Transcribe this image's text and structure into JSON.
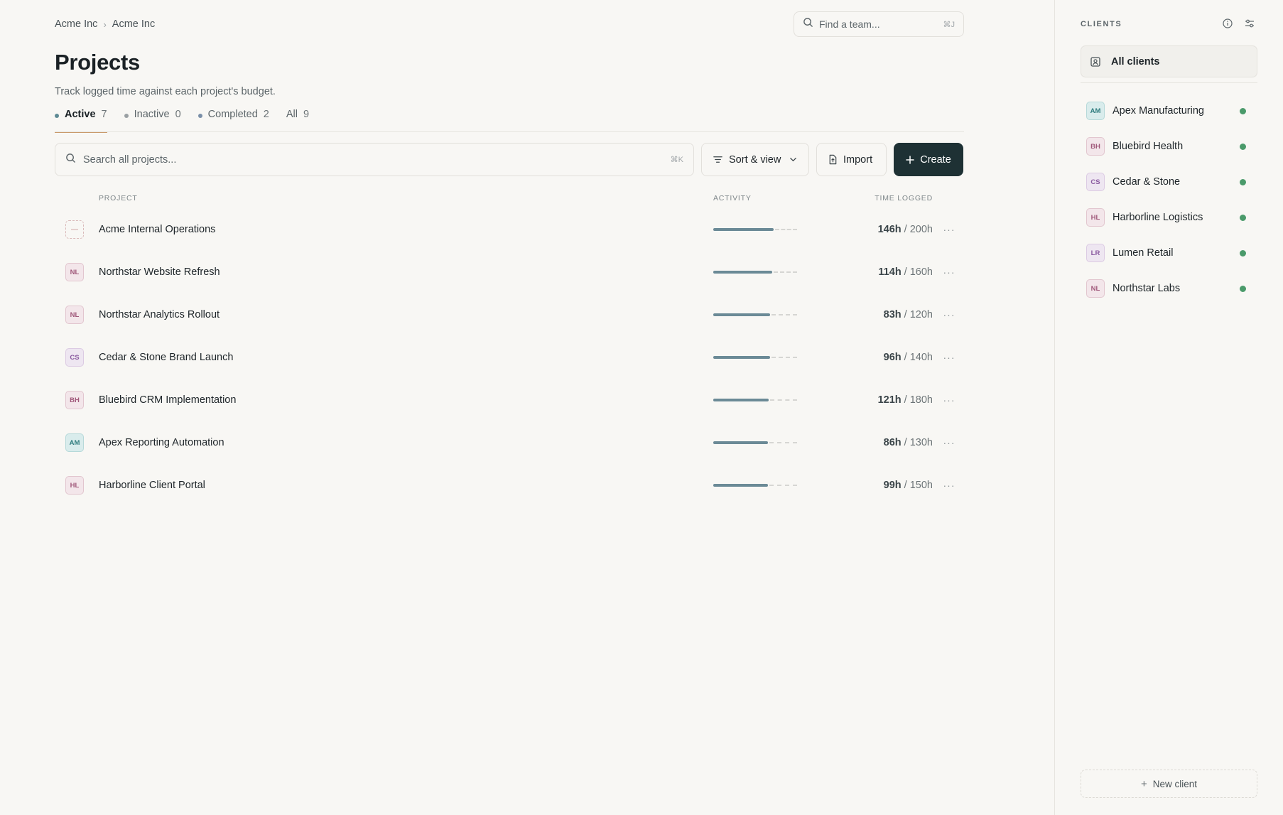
{
  "breadcrumb": [
    "Acme Inc",
    "Acme Inc"
  ],
  "team_search": {
    "placeholder": "Find a team...",
    "shortcut": "⌘J"
  },
  "page": {
    "title": "Projects",
    "subtitle": "Track logged time against each project's budget."
  },
  "tabs": [
    {
      "label": "Active",
      "count": "7",
      "active": true,
      "dot_color": "#5e8a94"
    },
    {
      "label": "Inactive",
      "count": "0",
      "active": false,
      "dot_color": "#9aa0a3"
    },
    {
      "label": "Completed",
      "count": "2",
      "active": false,
      "dot_color": "#7a8fa8"
    },
    {
      "label": "All",
      "count": "9",
      "active": false,
      "dot_color": null
    }
  ],
  "toolbar": {
    "search_placeholder": "Search all projects...",
    "search_shortcut": "⌘K",
    "sort_label": "Sort & view",
    "import_label": "Import",
    "create_label": "Create"
  },
  "table": {
    "columns": {
      "project": "PROJECT",
      "activity": "ACTIVITY",
      "time": "TIME LOGGED"
    },
    "rows": [
      {
        "initials": "",
        "name": "Acme Internal Operations",
        "logged": "146h",
        "budget": "/ 200h",
        "ratio": 0.73,
        "client_color": "none"
      },
      {
        "initials": "NL",
        "name": "Northstar Website Refresh",
        "logged": "114h",
        "budget": "/ 160h",
        "ratio": 0.71,
        "client_color": "pink"
      },
      {
        "initials": "NL",
        "name": "Northstar Analytics Rollout",
        "logged": "83h",
        "budget": "/ 120h",
        "ratio": 0.69,
        "client_color": "pink"
      },
      {
        "initials": "CS",
        "name": "Cedar & Stone Brand Launch",
        "logged": "96h",
        "budget": "/ 140h",
        "ratio": 0.69,
        "client_color": "purple"
      },
      {
        "initials": "BH",
        "name": "Bluebird CRM Implementation",
        "logged": "121h",
        "budget": "/ 180h",
        "ratio": 0.67,
        "client_color": "pink"
      },
      {
        "initials": "AM",
        "name": "Apex Reporting Automation",
        "logged": "86h",
        "budget": "/ 130h",
        "ratio": 0.66,
        "client_color": "teal"
      },
      {
        "initials": "HL",
        "name": "Harborline Client Portal",
        "logged": "99h",
        "budget": "/ 150h",
        "ratio": 0.66,
        "client_color": "pink"
      }
    ]
  },
  "sidebar": {
    "title": "CLIENTS",
    "all_clients_label": "All clients",
    "clients": [
      {
        "initials": "AM",
        "name": "Apex Manufacturing",
        "client_color": "teal",
        "status_color": "#4a9a6a"
      },
      {
        "initials": "BH",
        "name": "Bluebird Health",
        "client_color": "pink",
        "status_color": "#4a9a6a"
      },
      {
        "initials": "CS",
        "name": "Cedar & Stone",
        "client_color": "purple",
        "status_color": "#4a9a6a"
      },
      {
        "initials": "HL",
        "name": "Harborline Logistics",
        "client_color": "pink",
        "status_color": "#4a9a6a"
      },
      {
        "initials": "LR",
        "name": "Lumen Retail",
        "client_color": "purple",
        "status_color": "#4a9a6a"
      },
      {
        "initials": "NL",
        "name": "Northstar Labs",
        "client_color": "pink",
        "status_color": "#4a9a6a"
      }
    ],
    "new_client_label": "New client"
  },
  "colors": {
    "accent_dark": "#1e3134",
    "tab_underline": "#c99a6b",
    "progress_fill": "#6b8a96",
    "avatar_pink": {
      "bg": "#f3e6ea",
      "border": "#e2c6cf",
      "fg": "#a0587a"
    },
    "avatar_purple": {
      "bg": "#eee6f1",
      "border": "#dccbe3",
      "fg": "#8a5aa0"
    },
    "avatar_teal": {
      "bg": "#d9ecec",
      "border": "#b6d9d9",
      "fg": "#2f7c7e"
    }
  }
}
